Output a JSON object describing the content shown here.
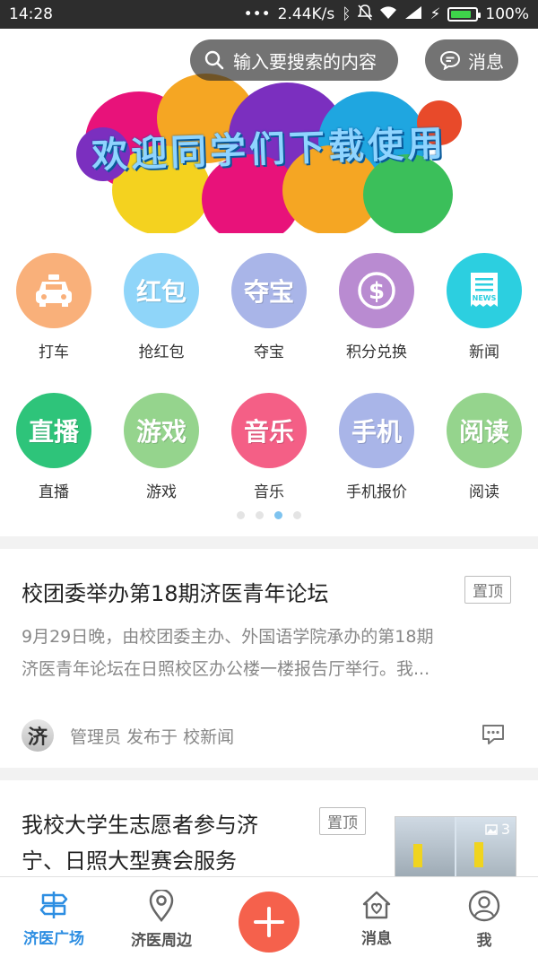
{
  "status_bar": {
    "time": "14:28",
    "speed": "2.44K/s",
    "battery": "100%"
  },
  "banner": {
    "text": "欢迎同学们下载使用"
  },
  "search": {
    "placeholder": "输入要搜索的内容"
  },
  "header": {
    "message_label": "消息"
  },
  "grid": {
    "rows": [
      [
        {
          "label": "打车",
          "icon": "taxi-icon",
          "color": "#f9b07a"
        },
        {
          "label": "抢红包",
          "icon": "red-packet-icon",
          "icon_text": "红包",
          "color": "#8fd5f9"
        },
        {
          "label": "夺宝",
          "icon": "treasure-icon",
          "icon_text": "夺宝",
          "color": "#a9b5e8"
        },
        {
          "label": "积分兑换",
          "icon": "coin-icon",
          "color": "#b98bd1"
        },
        {
          "label": "新闻",
          "icon": "news-icon",
          "color": "#2ccfe0"
        }
      ],
      [
        {
          "label": "直播",
          "icon": "live-icon",
          "icon_text": "直播",
          "color": "#2ec47a"
        },
        {
          "label": "游戏",
          "icon": "game-icon",
          "icon_text": "游戏",
          "color": "#95d48d"
        },
        {
          "label": "音乐",
          "icon": "music-icon",
          "icon_text": "音乐",
          "color": "#f45f86"
        },
        {
          "label": "手机报价",
          "icon": "phone-icon",
          "icon_text": "手机",
          "color": "#a9b5e8"
        },
        {
          "label": "阅读",
          "icon": "reading-icon",
          "icon_text": "阅读",
          "color": "#95d48d"
        }
      ]
    ]
  },
  "news": [
    {
      "title": "校团委举办第18期济医青年论坛",
      "pin": "置顶",
      "summary_line1": "9月29日晚，由校团委主办、外国语学院承办的第18期",
      "summary_line2": "济医青年论坛在日照校区办公楼一楼报告厅举行。我...",
      "avatar_text": "济",
      "meta": "管理员 发布于 校新闻"
    },
    {
      "title_line1": "我校大学生志愿者参与济",
      "title_line2": "宁、日照大型赛会服务",
      "pin": "置顶",
      "image_count": "3"
    }
  ],
  "tabs": [
    {
      "label": "济医广场",
      "icon": "signpost-icon"
    },
    {
      "label": "济医周边",
      "icon": "location-pin-icon"
    },
    {
      "label": "",
      "icon": "plus-icon"
    },
    {
      "label": "消息",
      "icon": "house-heart-icon"
    },
    {
      "label": "我",
      "icon": "user-icon"
    }
  ],
  "colors": {
    "accent": "#2d8ee2",
    "fab": "#f5614c",
    "dot_active": "#7ec3ef"
  }
}
